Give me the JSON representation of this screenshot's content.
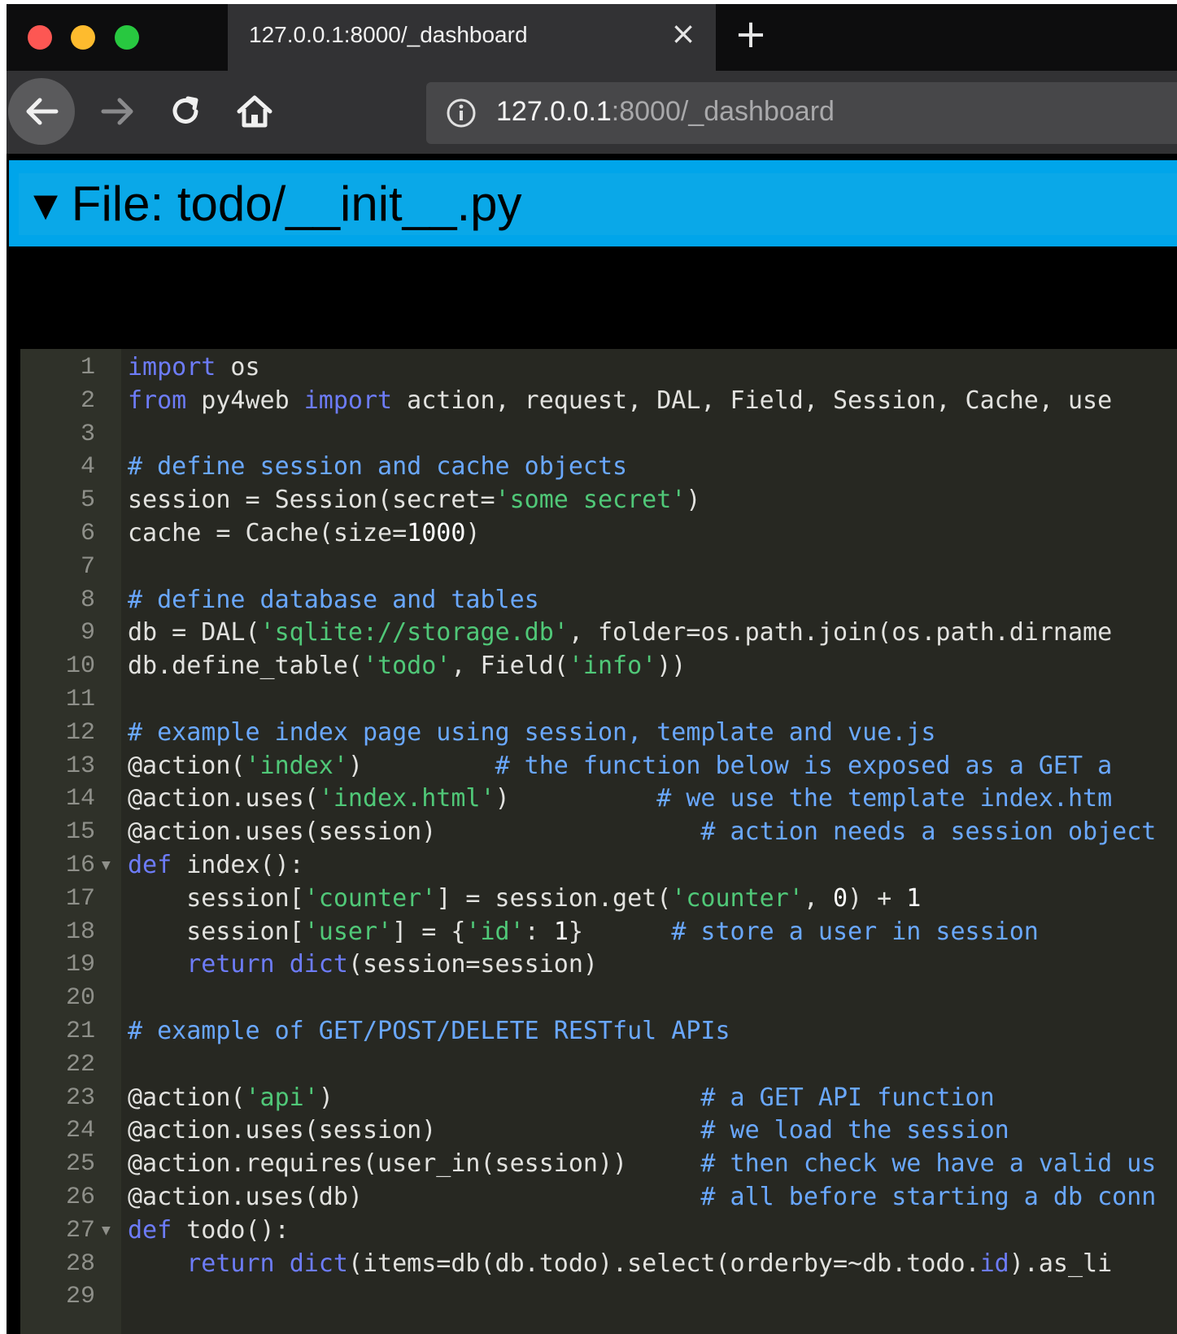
{
  "browser": {
    "tab_title": "127.0.0.1:8000/_dashboard",
    "tab_close_icon": "×",
    "new_tab_icon": "+",
    "url_host": "127.0.0.1",
    "url_rest": ":8000/_dashboard",
    "icons": {
      "back": "back-arrow-icon",
      "forward": "forward-arrow-icon",
      "reload": "reload-icon",
      "home": "home-icon",
      "info": "info-icon"
    }
  },
  "file_header": {
    "toggle": "▾",
    "title": "File: todo/__init__.py",
    "color": "#00a5ea"
  },
  "editor": {
    "line_numbers": [
      "1",
      "2",
      "3",
      "4",
      "5",
      "6",
      "7",
      "8",
      "9",
      "10",
      "11",
      "12",
      "13",
      "14",
      "15",
      "16",
      "17",
      "18",
      "19",
      "20",
      "21",
      "22",
      "23",
      "24",
      "25",
      "26",
      "27",
      "28",
      "29"
    ],
    "fold_lines": [
      "16",
      "27"
    ],
    "lines": [
      [
        [
          "kw",
          "import"
        ],
        [
          "t",
          " os"
        ]
      ],
      [
        [
          "kw",
          "from"
        ],
        [
          "t",
          " py4web "
        ],
        [
          "kw",
          "import"
        ],
        [
          "t",
          " action, request, DAL, Field, Session, Cache, use"
        ]
      ],
      [],
      [
        [
          "cm",
          "# define session and cache objects"
        ]
      ],
      [
        [
          "t",
          "session = Session(secret="
        ],
        [
          "str",
          "'some secret'"
        ],
        [
          "t",
          ")"
        ]
      ],
      [
        [
          "t",
          "cache = Cache(size="
        ],
        [
          "num",
          "1000"
        ],
        [
          "t",
          ")"
        ]
      ],
      [],
      [
        [
          "cm",
          "# define database and tables"
        ]
      ],
      [
        [
          "t",
          "db = DAL("
        ],
        [
          "str",
          "'sqlite://storage.db'"
        ],
        [
          "t",
          ", folder=os.path.join(os.path.dirname"
        ]
      ],
      [
        [
          "t",
          "db.define_table("
        ],
        [
          "str",
          "'todo'"
        ],
        [
          "t",
          ", Field("
        ],
        [
          "str",
          "'info'"
        ],
        [
          "t",
          "))"
        ]
      ],
      [],
      [
        [
          "cm",
          "# example index page using session, template and vue.js"
        ]
      ],
      [
        [
          "t",
          "@action("
        ],
        [
          "str",
          "'index'"
        ],
        [
          "t",
          ")         "
        ],
        [
          "cm",
          "# the function below is exposed as a GET a"
        ]
      ],
      [
        [
          "t",
          "@action.uses("
        ],
        [
          "str",
          "'index.html'"
        ],
        [
          "t",
          ")          "
        ],
        [
          "cm",
          "# we use the template index.htm"
        ]
      ],
      [
        [
          "t",
          "@action.uses(session)                  "
        ],
        [
          "cm",
          "# action needs a session object"
        ]
      ],
      [
        [
          "kw",
          "def"
        ],
        [
          "t",
          " index():"
        ]
      ],
      [
        [
          "t",
          "    session["
        ],
        [
          "str",
          "'counter'"
        ],
        [
          "t",
          "] = session.get("
        ],
        [
          "str",
          "'counter'"
        ],
        [
          "t",
          ", "
        ],
        [
          "num",
          "0"
        ],
        [
          "t",
          ") + "
        ],
        [
          "num",
          "1"
        ]
      ],
      [
        [
          "t",
          "    session["
        ],
        [
          "str",
          "'user'"
        ],
        [
          "t",
          "] = {"
        ],
        [
          "str",
          "'id'"
        ],
        [
          "t",
          ": "
        ],
        [
          "num",
          "1"
        ],
        [
          "t",
          "}      "
        ],
        [
          "cm",
          "# store a user in session"
        ]
      ],
      [
        [
          "t",
          "    "
        ],
        [
          "kw",
          "return"
        ],
        [
          "t",
          " "
        ],
        [
          "fn",
          "dict"
        ],
        [
          "t",
          "(session=session)"
        ]
      ],
      [],
      [
        [
          "cm",
          "# example of GET/POST/DELETE RESTful APIs"
        ]
      ],
      [],
      [
        [
          "t",
          "@action("
        ],
        [
          "str",
          "'api'"
        ],
        [
          "t",
          ")                         "
        ],
        [
          "cm",
          "# a GET API function"
        ]
      ],
      [
        [
          "t",
          "@action.uses(session)                  "
        ],
        [
          "cm",
          "# we load the session"
        ]
      ],
      [
        [
          "t",
          "@action.requires(user_in(session))     "
        ],
        [
          "cm",
          "# then check we have a valid us"
        ]
      ],
      [
        [
          "t",
          "@action.uses(db)                       "
        ],
        [
          "cm",
          "# all before starting a db conn"
        ]
      ],
      [
        [
          "kw",
          "def"
        ],
        [
          "t",
          " todo():"
        ]
      ],
      [
        [
          "t",
          "    "
        ],
        [
          "kw",
          "return"
        ],
        [
          "t",
          " "
        ],
        [
          "fn",
          "dict"
        ],
        [
          "t",
          "(items=db(db.todo).select(orderby=~db.todo."
        ],
        [
          "fn",
          "id"
        ],
        [
          "t",
          ").as_li"
        ]
      ],
      []
    ]
  }
}
